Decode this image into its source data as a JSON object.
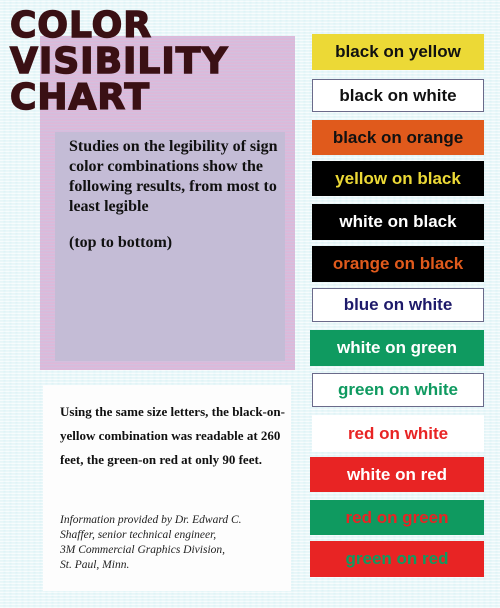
{
  "title": {
    "line1": "COLOR",
    "line2": "VISIBILITY",
    "line3": "CHART"
  },
  "intro": {
    "text": "Studies on the legibility of sign color combinations show the following results, from most to least legible",
    "note": "(top to bottom)"
  },
  "statistic": {
    "text": "Using the same size letters, the black-on-yellow combination was readable at 260 feet, the green-on red at only 90 feet."
  },
  "credit": {
    "line1": "Information provided by Dr. Edward C.",
    "line2": "Shaffer, senior technical engineer,",
    "line3": "3M Commercial Graphics Division,",
    "line4": "St. Paul, Minn."
  },
  "combinations": [
    {
      "label": "black on yellow",
      "fg": "#111111",
      "bg": "#ecd936",
      "border": false
    },
    {
      "label": "black on white",
      "fg": "#111111",
      "bg": "#ffffff",
      "border": true
    },
    {
      "label": "black on orange",
      "fg": "#111111",
      "bg": "#e05a1c",
      "border": false
    },
    {
      "label": "yellow on black",
      "fg": "#ecd936",
      "bg": "#000000",
      "border": false
    },
    {
      "label": "white on black",
      "fg": "#ffffff",
      "bg": "#000000",
      "border": false
    },
    {
      "label": "orange on black",
      "fg": "#e05a1c",
      "bg": "#000000",
      "border": false
    },
    {
      "label": "blue on white",
      "fg": "#1e1a6a",
      "bg": "#ffffff",
      "border": true
    },
    {
      "label": "white on green",
      "fg": "#ffffff",
      "bg": "#0f9a60",
      "border": false
    },
    {
      "label": "green on white",
      "fg": "#0f9a60",
      "bg": "#ffffff",
      "border": true
    },
    {
      "label": "red on white",
      "fg": "#e82424",
      "bg": "#ffffff",
      "border": false
    },
    {
      "label": "white on red",
      "fg": "#ffffff",
      "bg": "#e82424",
      "border": false
    },
    {
      "label": "red on green",
      "fg": "#e82424",
      "bg": "#0f9a60",
      "border": false
    },
    {
      "label": "green on red",
      "fg": "#0f9a60",
      "bg": "#e82424",
      "border": false
    }
  ]
}
